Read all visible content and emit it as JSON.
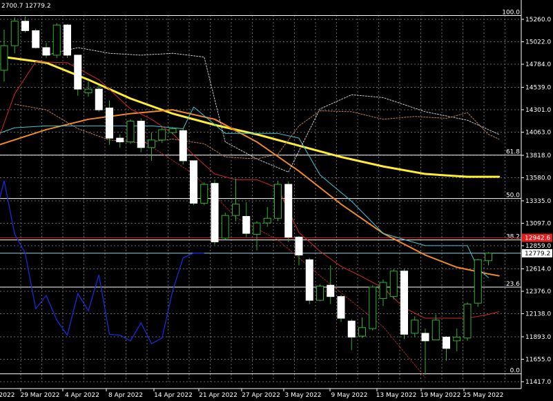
{
  "header": {
    "text": "2700.7 12779.2"
  },
  "chart_data": {
    "type": "candlestick",
    "x_labels": [
      "2022",
      "29 Mar 2022",
      "4 Apr 2022",
      "8 Apr 2022",
      "14 Apr 2022",
      "21 Apr 2022",
      "27 Apr 2022",
      "3 May 2022",
      "9 May 2022",
      "13 May 2022",
      "19 May 2022",
      "25 May 2022"
    ],
    "y_ticks": [
      15260.0,
      15022.0,
      14784.0,
      14539.0,
      14301.0,
      14063.0,
      13818.0,
      13580.0,
      13335.0,
      13097.0,
      12859.0,
      12614.0,
      12376.0,
      12138.0,
      11893.0,
      11655.0,
      11417.0
    ],
    "y_tick_labels": [
      "15260.0",
      "15022.0",
      "14784.0",
      "14539.0",
      "14301.0",
      "14063.0",
      "13818.0",
      "13580.0",
      "13335.0",
      "13097.0",
      "12859.0",
      "12614.0",
      "12376.0",
      "12138.0",
      "11893.0",
      "11655.0",
      "11417.0"
    ],
    "ylim": [
      11400,
      15350
    ],
    "candles": [
      {
        "o": 14720,
        "h": 15150,
        "l": 14600,
        "c": 14980
      },
      {
        "o": 14980,
        "h": 15280,
        "l": 14900,
        "c": 15240
      },
      {
        "o": 15240,
        "h": 15290,
        "l": 15120,
        "c": 15140
      },
      {
        "o": 15140,
        "h": 15160,
        "l": 14950,
        "c": 14960
      },
      {
        "o": 14960,
        "h": 15010,
        "l": 14850,
        "c": 14880
      },
      {
        "o": 14880,
        "h": 15220,
        "l": 14850,
        "c": 15200
      },
      {
        "o": 15200,
        "h": 15210,
        "l": 14850,
        "c": 14880
      },
      {
        "o": 14880,
        "h": 14880,
        "l": 14450,
        "c": 14520
      },
      {
        "o": 14480,
        "h": 14600,
        "l": 14440,
        "c": 14520
      },
      {
        "o": 14520,
        "h": 14560,
        "l": 14280,
        "c": 14300
      },
      {
        "o": 14320,
        "h": 14400,
        "l": 13930,
        "c": 14000
      },
      {
        "o": 14000,
        "h": 14040,
        "l": 13900,
        "c": 13960
      },
      {
        "o": 13960,
        "h": 14200,
        "l": 13940,
        "c": 14180
      },
      {
        "o": 14180,
        "h": 14210,
        "l": 13850,
        "c": 13900
      },
      {
        "o": 13900,
        "h": 14060,
        "l": 13760,
        "c": 13980
      },
      {
        "o": 13980,
        "h": 14120,
        "l": 13950,
        "c": 14090
      },
      {
        "o": 14060,
        "h": 14120,
        "l": 14040,
        "c": 14100
      },
      {
        "o": 14080,
        "h": 14100,
        "l": 13720,
        "c": 13760
      },
      {
        "o": 13760,
        "h": 13760,
        "l": 13290,
        "c": 13310
      },
      {
        "o": 13310,
        "h": 13530,
        "l": 13290,
        "c": 13510
      },
      {
        "o": 13520,
        "h": 13560,
        "l": 12870,
        "c": 12900
      },
      {
        "o": 12940,
        "h": 13210,
        "l": 12920,
        "c": 13180
      },
      {
        "o": 13180,
        "h": 13570,
        "l": 13120,
        "c": 13300
      },
      {
        "o": 13170,
        "h": 13320,
        "l": 12950,
        "c": 12990
      },
      {
        "o": 12980,
        "h": 13120,
        "l": 12810,
        "c": 13100
      },
      {
        "o": 13100,
        "h": 13270,
        "l": 13060,
        "c": 13150
      },
      {
        "o": 13150,
        "h": 13550,
        "l": 13120,
        "c": 13510
      },
      {
        "o": 13510,
        "h": 13540,
        "l": 12900,
        "c": 12950
      },
      {
        "o": 12950,
        "h": 12960,
        "l": 12650,
        "c": 12760
      },
      {
        "o": 12710,
        "h": 12730,
        "l": 12240,
        "c": 12280
      },
      {
        "o": 12280,
        "h": 12450,
        "l": 12270,
        "c": 12430
      },
      {
        "o": 12440,
        "h": 12650,
        "l": 12240,
        "c": 12320
      },
      {
        "o": 12320,
        "h": 12340,
        "l": 12050,
        "c": 12090
      },
      {
        "o": 12060,
        "h": 12080,
        "l": 11750,
        "c": 11890
      },
      {
        "o": 11900,
        "h": 12100,
        "l": 11880,
        "c": 11990
      },
      {
        "o": 11980,
        "h": 12440,
        "l": 11960,
        "c": 12420
      },
      {
        "o": 12300,
        "h": 12500,
        "l": 12220,
        "c": 12470
      },
      {
        "o": 12320,
        "h": 12610,
        "l": 12290,
        "c": 12590
      },
      {
        "o": 12590,
        "h": 12610,
        "l": 11870,
        "c": 11920
      },
      {
        "o": 11930,
        "h": 12110,
        "l": 11890,
        "c": 12070
      },
      {
        "o": 11930,
        "h": 11980,
        "l": 11490,
        "c": 11850
      },
      {
        "o": 11860,
        "h": 12130,
        "l": 11890,
        "c": 12070
      },
      {
        "o": 11890,
        "h": 11900,
        "l": 11640,
        "c": 11770
      },
      {
        "o": 11850,
        "h": 11980,
        "l": 11740,
        "c": 11890
      },
      {
        "o": 11880,
        "h": 12260,
        "l": 11850,
        "c": 12240
      },
      {
        "o": 12250,
        "h": 12720,
        "l": 12210,
        "c": 12710
      },
      {
        "o": 12700,
        "h": 12790,
        "l": 12650,
        "c": 12779.2
      }
    ],
    "fibonacci": [
      {
        "label": "100.0",
        "value": 15300
      },
      {
        "label": "61.8",
        "value": 13820
      },
      {
        "label": "50.0",
        "value": 13360
      },
      {
        "label": "38.2",
        "value": 12920
      },
      {
        "label": "23.6",
        "value": 12420
      },
      {
        "label": "0.0",
        "value": 11500
      }
    ],
    "price_tags": [
      {
        "label": "12942.6",
        "value": 12942.6,
        "bg": "#e02020",
        "color": "#ffffff"
      },
      {
        "label": "12779.2",
        "value": 12779.2,
        "bg": "#ffffff",
        "color": "#000000"
      }
    ],
    "overlays": [
      {
        "name": "yellow-ma",
        "color": "#ffee33",
        "width": 3,
        "x": [
          0,
          4,
          8,
          12,
          16,
          20,
          24,
          28,
          32,
          36,
          40,
          44,
          47
        ],
        "y": [
          14860,
          14800,
          14620,
          14420,
          14260,
          14140,
          14040,
          13920,
          13800,
          13700,
          13620,
          13590,
          13590
        ]
      },
      {
        "name": "orange-ma",
        "color": "#f08a28",
        "width": 2,
        "x": [
          -1,
          4,
          8,
          12,
          16,
          20,
          24,
          28,
          32,
          36,
          40,
          43,
          46,
          47
        ],
        "y": [
          13910,
          14090,
          14200,
          14260,
          14300,
          14200,
          13960,
          13650,
          13300,
          12990,
          12760,
          12630,
          12560,
          12540
        ]
      },
      {
        "name": "cyan-line",
        "color": "#3fc8d8",
        "width": 1,
        "x": [
          -1,
          1,
          4,
          10,
          14,
          17,
          18,
          21,
          26,
          28,
          30,
          33,
          36,
          40,
          44,
          45,
          46
        ],
        "y": [
          14030,
          14110,
          14130,
          14130,
          14130,
          14100,
          14330,
          14050,
          14050,
          14000,
          13610,
          13330,
          12990,
          12860,
          12860,
          12620,
          12520
        ]
      },
      {
        "name": "red-line",
        "color": "#d62828",
        "width": 1,
        "x": [
          -1,
          1,
          3,
          6,
          9,
          12,
          14,
          16,
          18,
          20,
          22,
          24,
          26,
          28,
          30,
          32,
          34,
          36,
          38,
          40,
          42,
          44,
          46,
          47
        ],
        "y": [
          13850,
          14470,
          14810,
          14800,
          14620,
          14310,
          14200,
          14050,
          13820,
          13620,
          13560,
          13560,
          13470,
          13000,
          12800,
          12640,
          12530,
          12410,
          12200,
          12090,
          12090,
          12090,
          12130,
          12160
        ]
      },
      {
        "name": "tenkan-dotted",
        "color": "#aa2222",
        "width": 1,
        "dash": "2,2",
        "x": [
          13,
          18,
          22,
          26,
          30,
          36,
          40
        ],
        "y": [
          13980,
          13620,
          13160,
          12920,
          12540,
          12000,
          11460
        ]
      },
      {
        "name": "cloud-upper",
        "color": "#cccccc",
        "width": 1,
        "dash": "2,2",
        "x": [
          4,
          7,
          10,
          13,
          16,
          19,
          21,
          24,
          27,
          30,
          33,
          36,
          40,
          44,
          47
        ],
        "y": [
          14880,
          14960,
          14900,
          14880,
          14900,
          14860,
          13960,
          13780,
          13640,
          14310,
          14460,
          14430,
          14280,
          14190,
          14040
        ]
      },
      {
        "name": "cloud-lower",
        "color": "#c08050",
        "width": 1,
        "dash": "2,2",
        "x": [
          1,
          4,
          7,
          10,
          13,
          16,
          19,
          21,
          24,
          26,
          28,
          30,
          33,
          36,
          39,
          42,
          44,
          46,
          47
        ],
        "y": [
          14360,
          14300,
          14100,
          13980,
          13950,
          13990,
          13940,
          13800,
          13780,
          13830,
          14130,
          14290,
          14280,
          14200,
          14230,
          14210,
          14270,
          14040,
          13990
        ]
      }
    ],
    "oscillator": {
      "name": "blue-oscillator",
      "color": "#1a2ad8",
      "x": [
        -1,
        0,
        1,
        2,
        3,
        4,
        5,
        6,
        7,
        8,
        9,
        10,
        11,
        12,
        13,
        14,
        15,
        16,
        17,
        18,
        19
      ],
      "y": [
        13100,
        13550,
        12980,
        12780,
        12190,
        12330,
        12070,
        11910,
        12350,
        12170,
        12550,
        11920,
        11910,
        11850,
        12040,
        11820,
        11880,
        12380,
        12730,
        12780,
        12780
      ]
    }
  }
}
